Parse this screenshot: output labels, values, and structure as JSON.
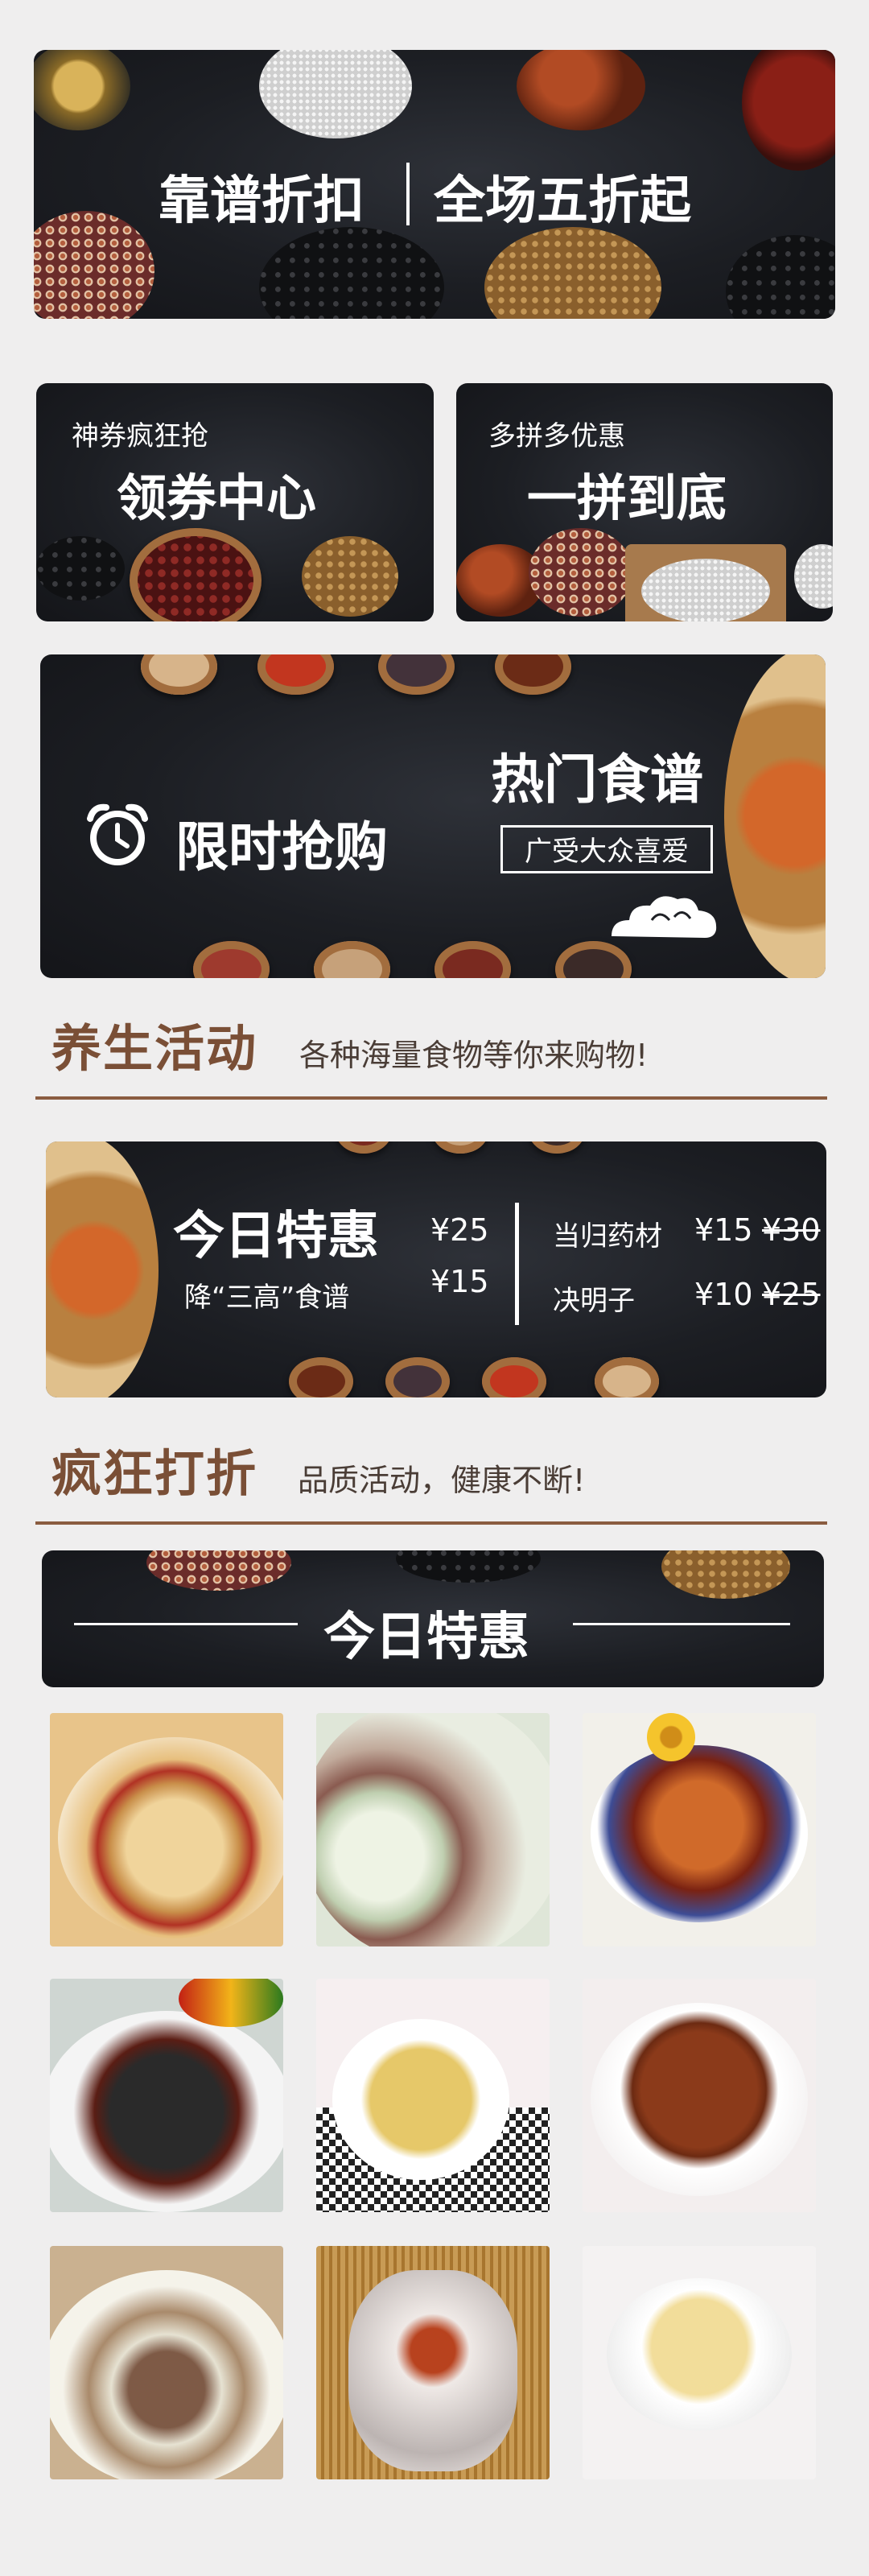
{
  "banner": {
    "left": "靠谱折扣",
    "right": "全场五折起"
  },
  "coupon_card": {
    "small": "神券疯狂抢",
    "big": "领券中心"
  },
  "group_card": {
    "small": "多拼多优惠",
    "big": "一拼到底"
  },
  "flash": {
    "label": "限时抢购",
    "recipe_title": "热门食谱",
    "recipe_badge": "广受大众喜爱"
  },
  "section1": {
    "title": "养生活动",
    "subtitle": "各种海量食物等你来购物!"
  },
  "deal_banner": {
    "title": "今日特惠",
    "subtitle": "降“三高”食谱",
    "price1": "¥25",
    "price2": "¥15",
    "items": [
      {
        "name": "当归药材",
        "price": "¥15",
        "old_price": "¥30"
      },
      {
        "name": "决明子",
        "price": "¥10",
        "old_price": "¥25"
      }
    ]
  },
  "section2": {
    "title": "疯狂打折",
    "subtitle": "品质活动，健康不断!"
  },
  "today_header": {
    "title": "今日特惠"
  },
  "food_grid": [
    {
      "icon": "chicken-soup-photo"
    },
    {
      "icon": "wintermelon-rib-photo"
    },
    {
      "icon": "braised-pork-trotter-photo"
    },
    {
      "icon": "black-chicken-photo"
    },
    {
      "icon": "mushroom-soup-photo"
    },
    {
      "icon": "herbal-soup-photo"
    },
    {
      "icon": "radish-rib-soup-photo"
    },
    {
      "icon": "dessert-jelly-photo"
    },
    {
      "icon": "tremella-soup-photo"
    }
  ],
  "colors": {
    "dark_bg": "#1c1e23",
    "heading_brown": "#7a4f36",
    "line_brown": "#8a5c40",
    "page_bg": "#efeeee"
  }
}
